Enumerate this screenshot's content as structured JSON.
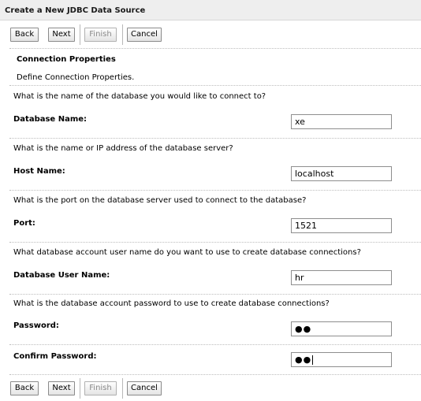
{
  "window": {
    "title": "Create a New JDBC Data Source"
  },
  "buttons": {
    "back": "Back",
    "next": "Next",
    "finish": "Finish",
    "cancel": "Cancel"
  },
  "section": {
    "title": "Connection Properties",
    "description": "Define Connection Properties."
  },
  "fields": [
    {
      "question": "What is the name of the database you would like to connect to?",
      "label": "Database Name:",
      "value": "xe"
    },
    {
      "question": "What is the name or IP address of the database server?",
      "label": "Host Name:",
      "value": "localhost"
    },
    {
      "question": "What is the port on the database server used to connect to the database?",
      "label": "Port:",
      "value": "1521"
    },
    {
      "question": "What database account user name do you want to use to create database connections?",
      "label": "Database User Name:",
      "value": "hr"
    },
    {
      "question": "What is the database account password to use to create database connections?",
      "label": "Password:",
      "value": "●●"
    },
    {
      "label": "Confirm Password:",
      "value": "●●"
    }
  ]
}
